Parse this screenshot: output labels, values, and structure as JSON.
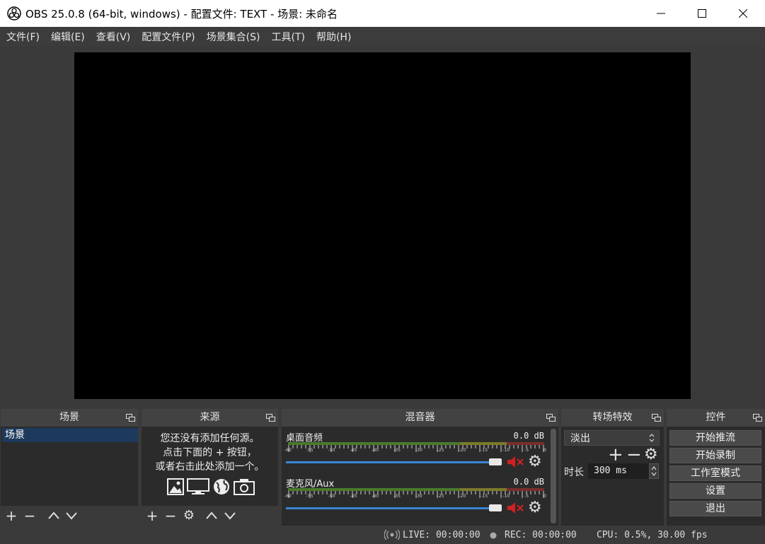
{
  "window": {
    "title": "OBS 25.0.8 (64-bit, windows) - 配置文件: TEXT - 场景: 未命名",
    "minimize_icon": "minimize-icon",
    "maximize_icon": "maximize-icon",
    "close_icon": "close-icon"
  },
  "menu": [
    "文件(F)",
    "编辑(E)",
    "查看(V)",
    "配置文件(P)",
    "场景集合(S)",
    "工具(T)",
    "帮助(H)"
  ],
  "scenes": {
    "title": "场景",
    "items": [
      "场景"
    ]
  },
  "sources": {
    "title": "来源",
    "empty_line1": "您还没有添加任何源。",
    "empty_line2": "点击下面的 + 按钮，",
    "empty_line3": "或者右击此处添加一个。"
  },
  "mixer": {
    "title": "混音器",
    "scale": [
      "-60",
      "-55",
      "-50",
      "-45",
      "-40",
      "-35",
      "-30",
      "-25",
      "-20",
      "-15",
      "-10",
      "-5",
      "0"
    ],
    "channels": [
      {
        "name": "桌面音频",
        "db": "0.0 dB",
        "muted": true
      },
      {
        "name": "麦克风/Aux",
        "db": "0.0 dB",
        "muted": true
      }
    ]
  },
  "transitions": {
    "title": "转场特效",
    "selected": "淡出",
    "duration_label": "时长",
    "duration_value": "300 ms"
  },
  "controls": {
    "title": "控件",
    "buttons": [
      "开始推流",
      "开始录制",
      "工作室模式",
      "设置",
      "退出"
    ]
  },
  "status": {
    "live": "LIVE: 00:00:00",
    "rec": "REC: 00:00:00",
    "cpu": "CPU: 0.5%, 30.00 fps"
  },
  "colors": {
    "accent": "#3a86d6",
    "selection": "#1d3a5c",
    "mute": "#d02020"
  }
}
